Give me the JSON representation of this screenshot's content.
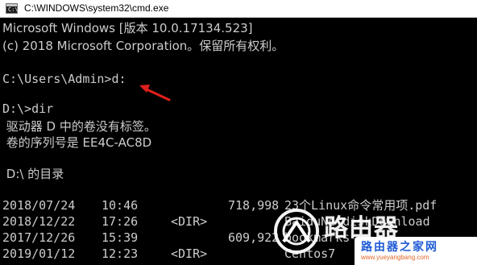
{
  "window": {
    "title": "C:\\WINDOWS\\system32\\cmd.exe",
    "icon": "cmd-icon"
  },
  "console": {
    "banner_line1": "Microsoft Windows [版本 10.0.17134.523]",
    "banner_line2": "(c) 2018 Microsoft Corporation。保留所有权利。",
    "prompt1": "C:\\Users\\Admin>d:",
    "prompt2": "D:\\>dir",
    "volume_label_line": " 驱动器 D 中的卷没有标签。",
    "serial_line": " 卷的序列号是 EE4C-AC8D",
    "dir_of_line": " D:\\ 的目录",
    "entries": [
      {
        "date": "2018/07/24",
        "time": "10:46",
        "dir": "",
        "size": "718,998",
        "name": "23个Linux命令常用项.pdf"
      },
      {
        "date": "2018/12/22",
        "time": "17:26",
        "dir": "<DIR>",
        "size": "",
        "name": "BaiduNetdiskDownload"
      },
      {
        "date": "2017/12/26",
        "time": "15:39",
        "dir": "",
        "size": "609,922",
        "name": "bookmarks"
      },
      {
        "date": "2019/01/12",
        "time": "12:23",
        "dir": "<DIR>",
        "size": "",
        "name": "Centos7"
      }
    ]
  },
  "annotation": {
    "arrow_color": "#e0201b"
  },
  "watermark": {
    "brand": "路由器",
    "site_name": "路由器之家网",
    "url": "www.yueyangbang.com"
  }
}
